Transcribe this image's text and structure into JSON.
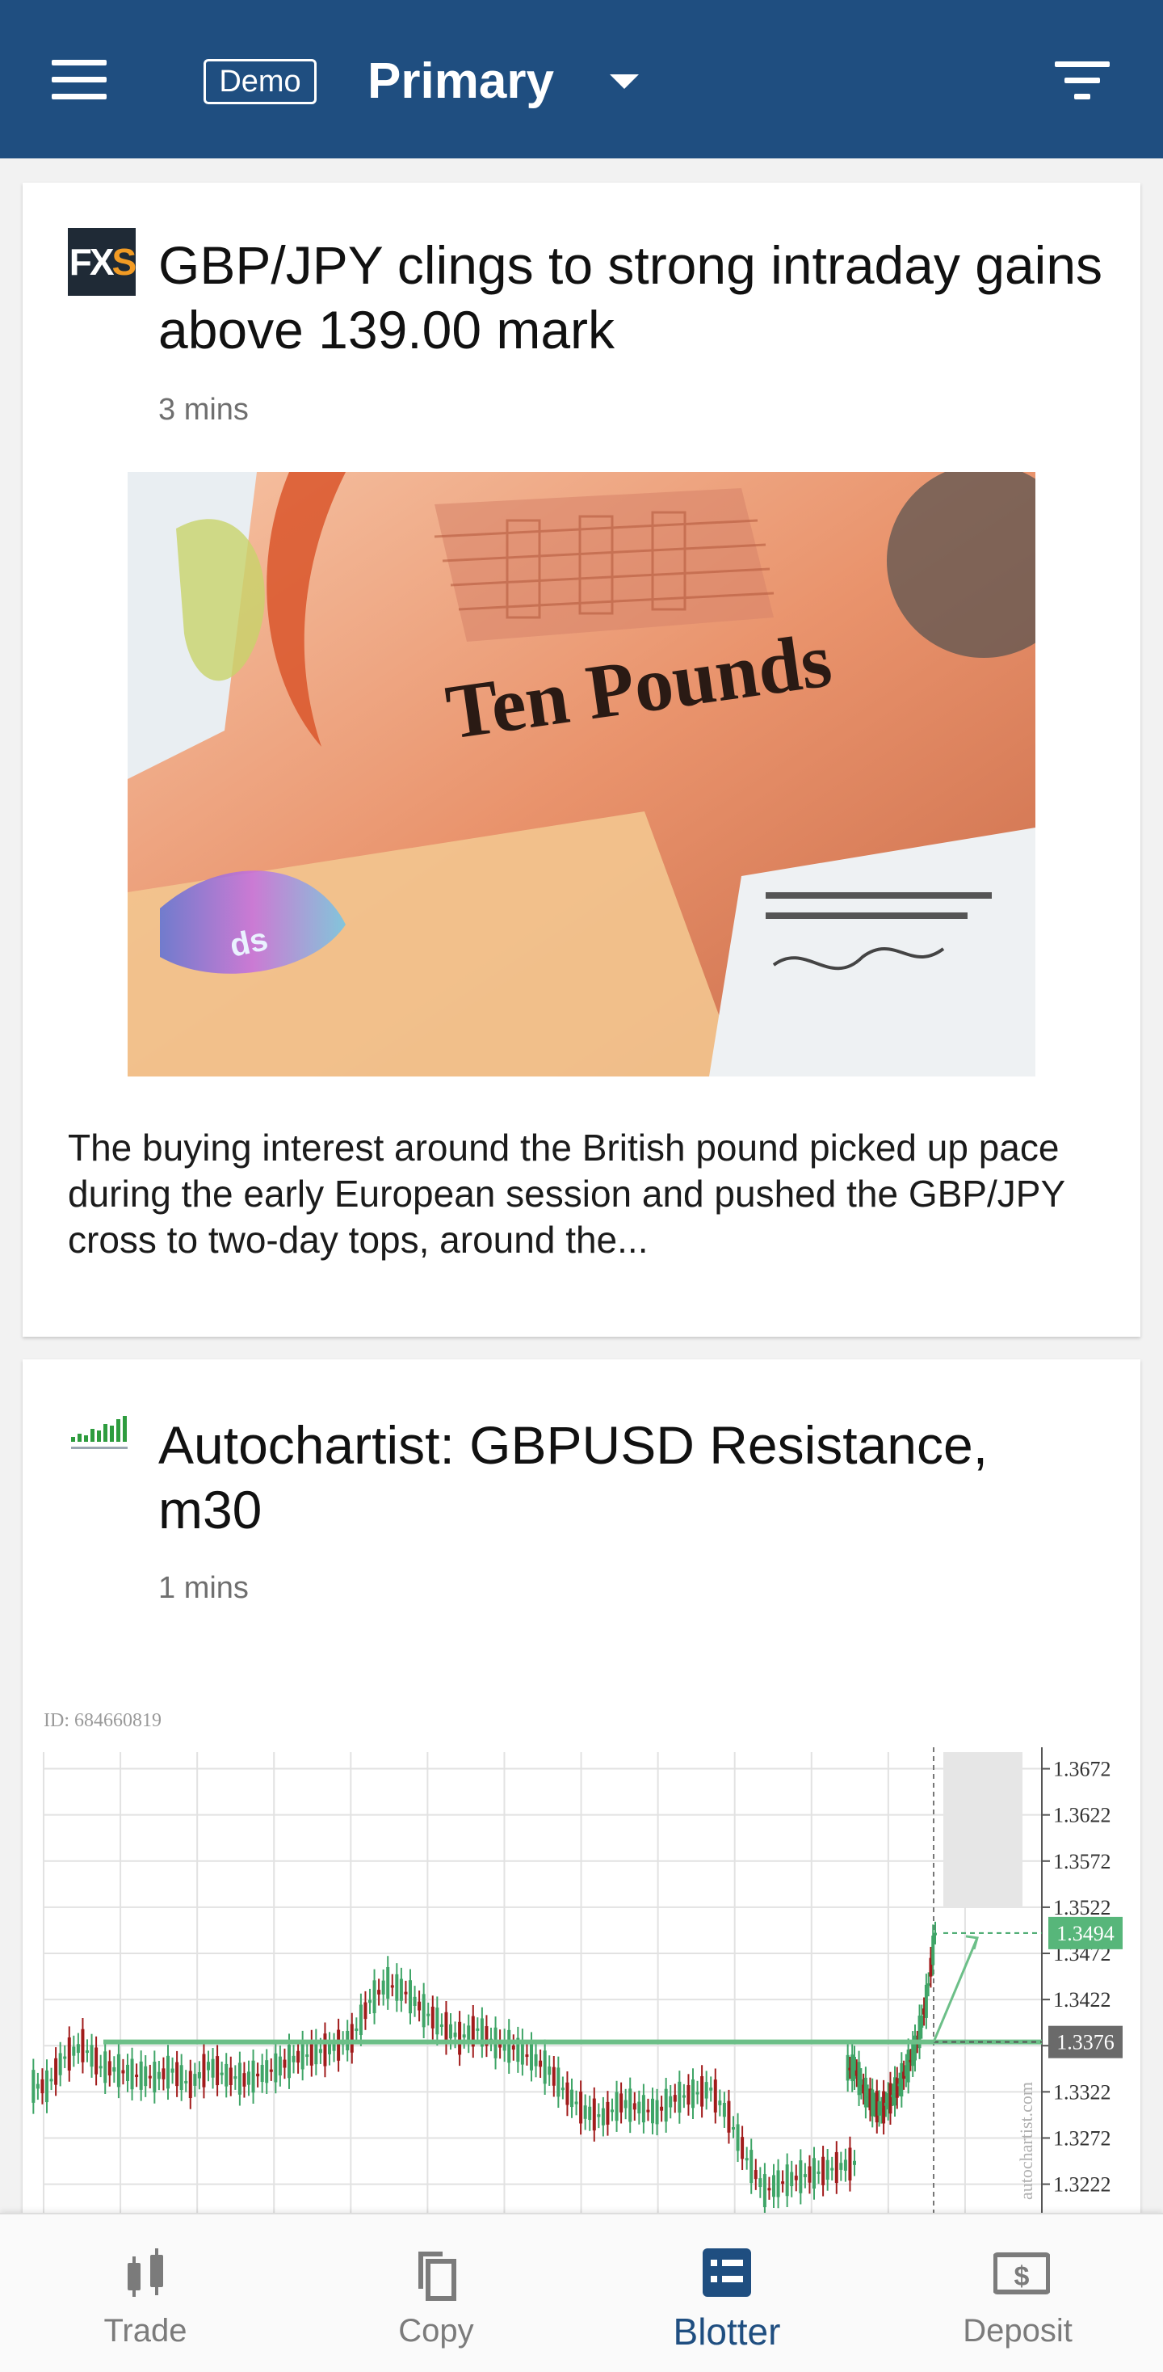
{
  "header": {
    "badge": "Demo",
    "account": "Primary"
  },
  "feed": [
    {
      "source_logo": "FXS",
      "title": "GBP/JPY clings to strong intraday gains above 139.00 mark",
      "time": "3 mins",
      "image_caption": "Ten Pounds",
      "summary": "The buying interest around the British pound picked up pace during the early European session and pushed the GBP/JPY cross to two-day tops, around the..."
    },
    {
      "source_logo": "autochartist",
      "title": "Autochartist: GBPUSD Resistance, m30",
      "time": "1 mins",
      "chart_id": "ID: 684660819",
      "watermark": "autochartist.com"
    }
  ],
  "chart_data": {
    "type": "line",
    "title": "",
    "xlabel": "",
    "ylabel": "",
    "ylim": [
      1.3205,
      1.369
    ],
    "y_ticks": [
      "1.3672",
      "1.3622",
      "1.3572",
      "1.3522",
      "1.3472",
      "1.3422",
      "1.3372",
      "1.3322",
      "1.3272",
      "1.3222"
    ],
    "resistance_level": 1.3376,
    "resistance_label": "1.3376",
    "target_level": 1.3494,
    "target_label": "1.3494",
    "grid": true,
    "series": [
      {
        "values": [
          1.3328,
          1.336,
          1.3372,
          1.335,
          1.3345,
          1.334,
          1.3338,
          1.3345,
          1.333,
          1.335,
          1.334,
          1.3335,
          1.3342,
          1.335,
          1.336,
          1.3365,
          1.337,
          1.338,
          1.342,
          1.344,
          1.343,
          1.341,
          1.3395,
          1.338,
          1.339,
          1.3375,
          1.337,
          1.336,
          1.3345,
          1.332,
          1.33,
          1.3295,
          1.331,
          1.3305,
          1.33,
          1.3315,
          1.332,
          1.3325,
          1.3295,
          1.325,
          1.3215,
          1.3225,
          1.323,
          1.3235,
          1.324,
          1.3245
        ]
      },
      {
        "values": [
          1.3348,
          1.3325,
          1.331,
          1.3302,
          1.3315,
          1.333,
          1.335,
          1.3376,
          1.342,
          1.3494
        ]
      }
    ]
  },
  "bottom_nav": [
    {
      "label": "Trade",
      "icon": "candlestick-icon"
    },
    {
      "label": "Copy",
      "icon": "copy-icon"
    },
    {
      "label": "Blotter",
      "icon": "blotter-icon"
    },
    {
      "label": "Deposit",
      "icon": "deposit-icon"
    }
  ],
  "colors": {
    "header": "#1f4e80",
    "chart_line": "#3fa567",
    "chart_dark": "#a11b1b",
    "active_nav": "#1f4e80"
  }
}
